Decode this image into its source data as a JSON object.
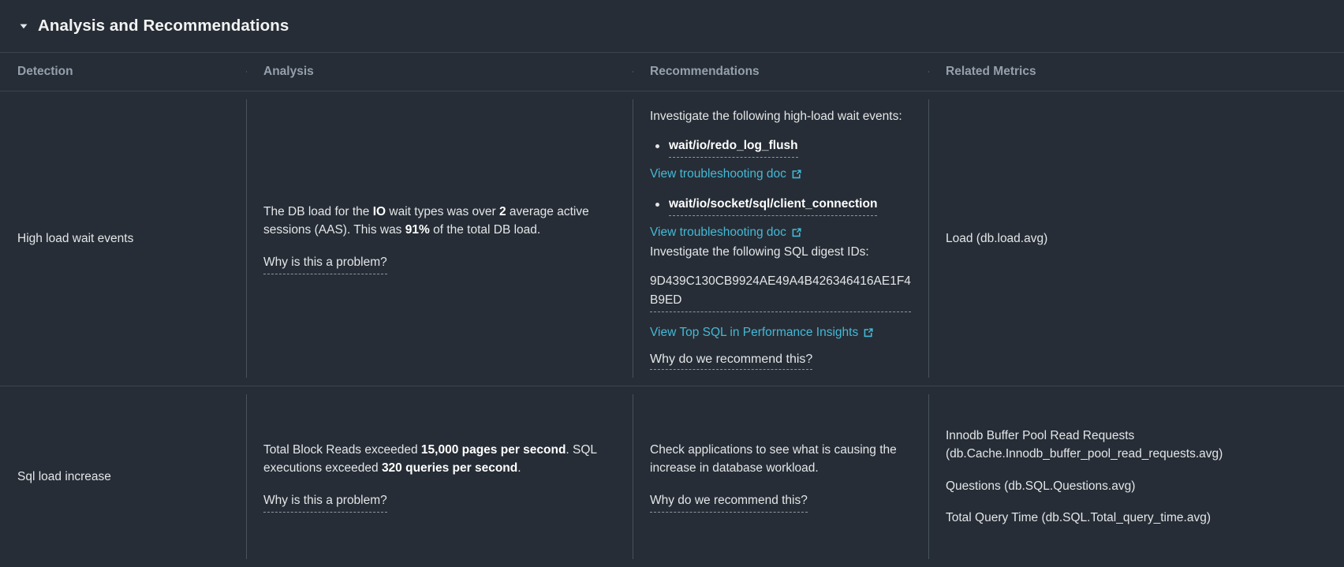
{
  "panel": {
    "title": "Analysis and Recommendations",
    "collapse_icon": "triangle-down-icon",
    "expanded": true
  },
  "colors": {
    "background": "#262d36",
    "link": "#44b9d6",
    "header_text": "#f2f3f3",
    "column_header_text": "#95a0ad",
    "body_text": "#e3e6e8",
    "divider": "#3c444f"
  },
  "table": {
    "columns": [
      {
        "key": "detection",
        "label": "Detection"
      },
      {
        "key": "analysis",
        "label": "Analysis"
      },
      {
        "key": "recommendations",
        "label": "Recommendations"
      },
      {
        "key": "related_metrics",
        "label": "Related Metrics"
      }
    ],
    "rows": [
      {
        "detection": "High load wait events",
        "analysis": {
          "sentence_parts": [
            "The DB load for the ",
            "IO",
            " wait types was over ",
            "2",
            " average active sessions (AAS). This was ",
            "91%",
            " of the total DB load."
          ],
          "why_link": "Why is this a problem?"
        },
        "recommendations": {
          "intro": "Investigate the following high-load wait events:",
          "wait_events": [
            {
              "name": "wait/io/redo_log_flush",
              "doc_link": "View troubleshooting doc"
            },
            {
              "name": "wait/io/socket/sql/client_connection",
              "doc_link": "View troubleshooting doc"
            }
          ],
          "digest_intro": "Investigate the following SQL digest IDs:",
          "digest_ids": [
            "9D439C130CB9924AE49A4B426346416AE1F4B9ED"
          ],
          "top_sql_link": "View Top SQL in Performance Insights",
          "why_link": "Why do we recommend this?"
        },
        "related_metrics": [
          "Load (db.load.avg)"
        ]
      },
      {
        "detection": "Sql load increase",
        "analysis": {
          "sentence_parts": [
            "Total Block Reads exceeded ",
            "15,000 pages per second",
            ". SQL executions exceeded ",
            "320 queries per second",
            "."
          ],
          "why_link": "Why is this a problem?"
        },
        "recommendations": {
          "text": "Check applications to see what is causing the increase in database workload.",
          "why_link": "Why do we recommend this?"
        },
        "related_metrics": [
          "Innodb Buffer Pool Read Requests (db.Cache.Innodb_buffer_pool_read_requests.avg)",
          "Questions (db.SQL.Questions.avg)",
          "Total Query Time (db.SQL.Total_query_time.avg)"
        ]
      }
    ]
  }
}
